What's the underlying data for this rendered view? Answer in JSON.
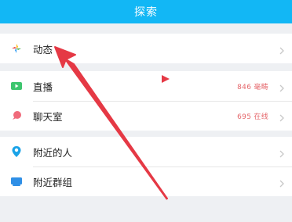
{
  "header": {
    "title": "探索"
  },
  "section1": {
    "items": [
      {
        "label": "动态",
        "icon": "moments-icon",
        "status": ""
      }
    ]
  },
  "section2": {
    "items": [
      {
        "label": "直播",
        "icon": "live-icon",
        "status": "846 毫畴"
      },
      {
        "label": "聊天室",
        "icon": "chatroom-icon",
        "status": "695 在线"
      }
    ]
  },
  "section3": {
    "items": [
      {
        "label": "附近的人",
        "icon": "location-pin-icon",
        "status": ""
      },
      {
        "label": "附近群组",
        "icon": "group-icon",
        "status": ""
      }
    ]
  },
  "colors": {
    "accent": "#12b7f5",
    "status": "#e5676b",
    "arrow": "#e53945"
  }
}
